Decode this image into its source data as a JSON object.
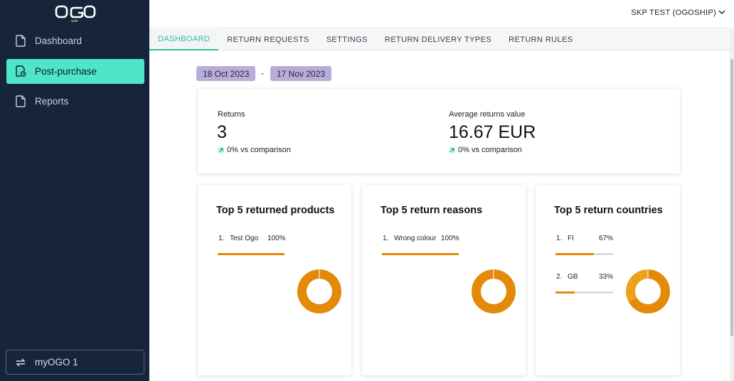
{
  "brand": {
    "logo_text": "OGO",
    "logo_sub": "SHIP"
  },
  "sidebar": {
    "items": [
      {
        "label": "Dashboard",
        "icon": "file-icon",
        "active": false
      },
      {
        "label": "Post-purchase",
        "icon": "post-purchase-icon",
        "active": true
      },
      {
        "label": "Reports",
        "icon": "file-icon",
        "active": false
      }
    ],
    "account": {
      "label": "myOGO 1",
      "icon": "switch-arrows-icon"
    }
  },
  "topbar": {
    "org_label": "SKP TEST (OGOSHIP)"
  },
  "tabs": [
    {
      "label": "DASHBOARD",
      "active": true
    },
    {
      "label": "RETURN REQUESTS",
      "active": false
    },
    {
      "label": "SETTINGS",
      "active": false
    },
    {
      "label": "RETURN DELIVERY TYPES",
      "active": false
    },
    {
      "label": "RETURN RULES",
      "active": false
    }
  ],
  "date_range": {
    "start": "18 Oct 2023",
    "separator": "-",
    "end": "17 Nov 2023"
  },
  "kpis": {
    "returns": {
      "label": "Returns",
      "value": "3",
      "trend": "0% vs comparison"
    },
    "avg_value": {
      "label": "Average returns value",
      "value": "16.67 EUR",
      "trend": "0% vs comparison"
    }
  },
  "products": {
    "title": "Top 5 returned products",
    "items": [
      {
        "rank": "1.",
        "name": "Test Ogo",
        "pct": "100%",
        "share": 1.0
      }
    ]
  },
  "reasons": {
    "title": "Top 5 return reasons",
    "items": [
      {
        "rank": "1.",
        "name": "Wrong colour",
        "pct": "100%",
        "share": 1.0
      }
    ]
  },
  "countries": {
    "title": "Top 5 return countries",
    "items": [
      {
        "rank": "1.",
        "name": "FI",
        "pct": "67%",
        "share": 0.67
      },
      {
        "rank": "2.",
        "name": "GB",
        "pct": "33%",
        "share": 0.33
      }
    ]
  },
  "colors": {
    "sidebar_bg": "#17253a",
    "active_nav": "#4ee6c7",
    "accent_tab": "#37b7a0",
    "date_chip": "#b8acd8",
    "chart_primary": "#e38a09",
    "chart_secondary": "#eea11a"
  }
}
